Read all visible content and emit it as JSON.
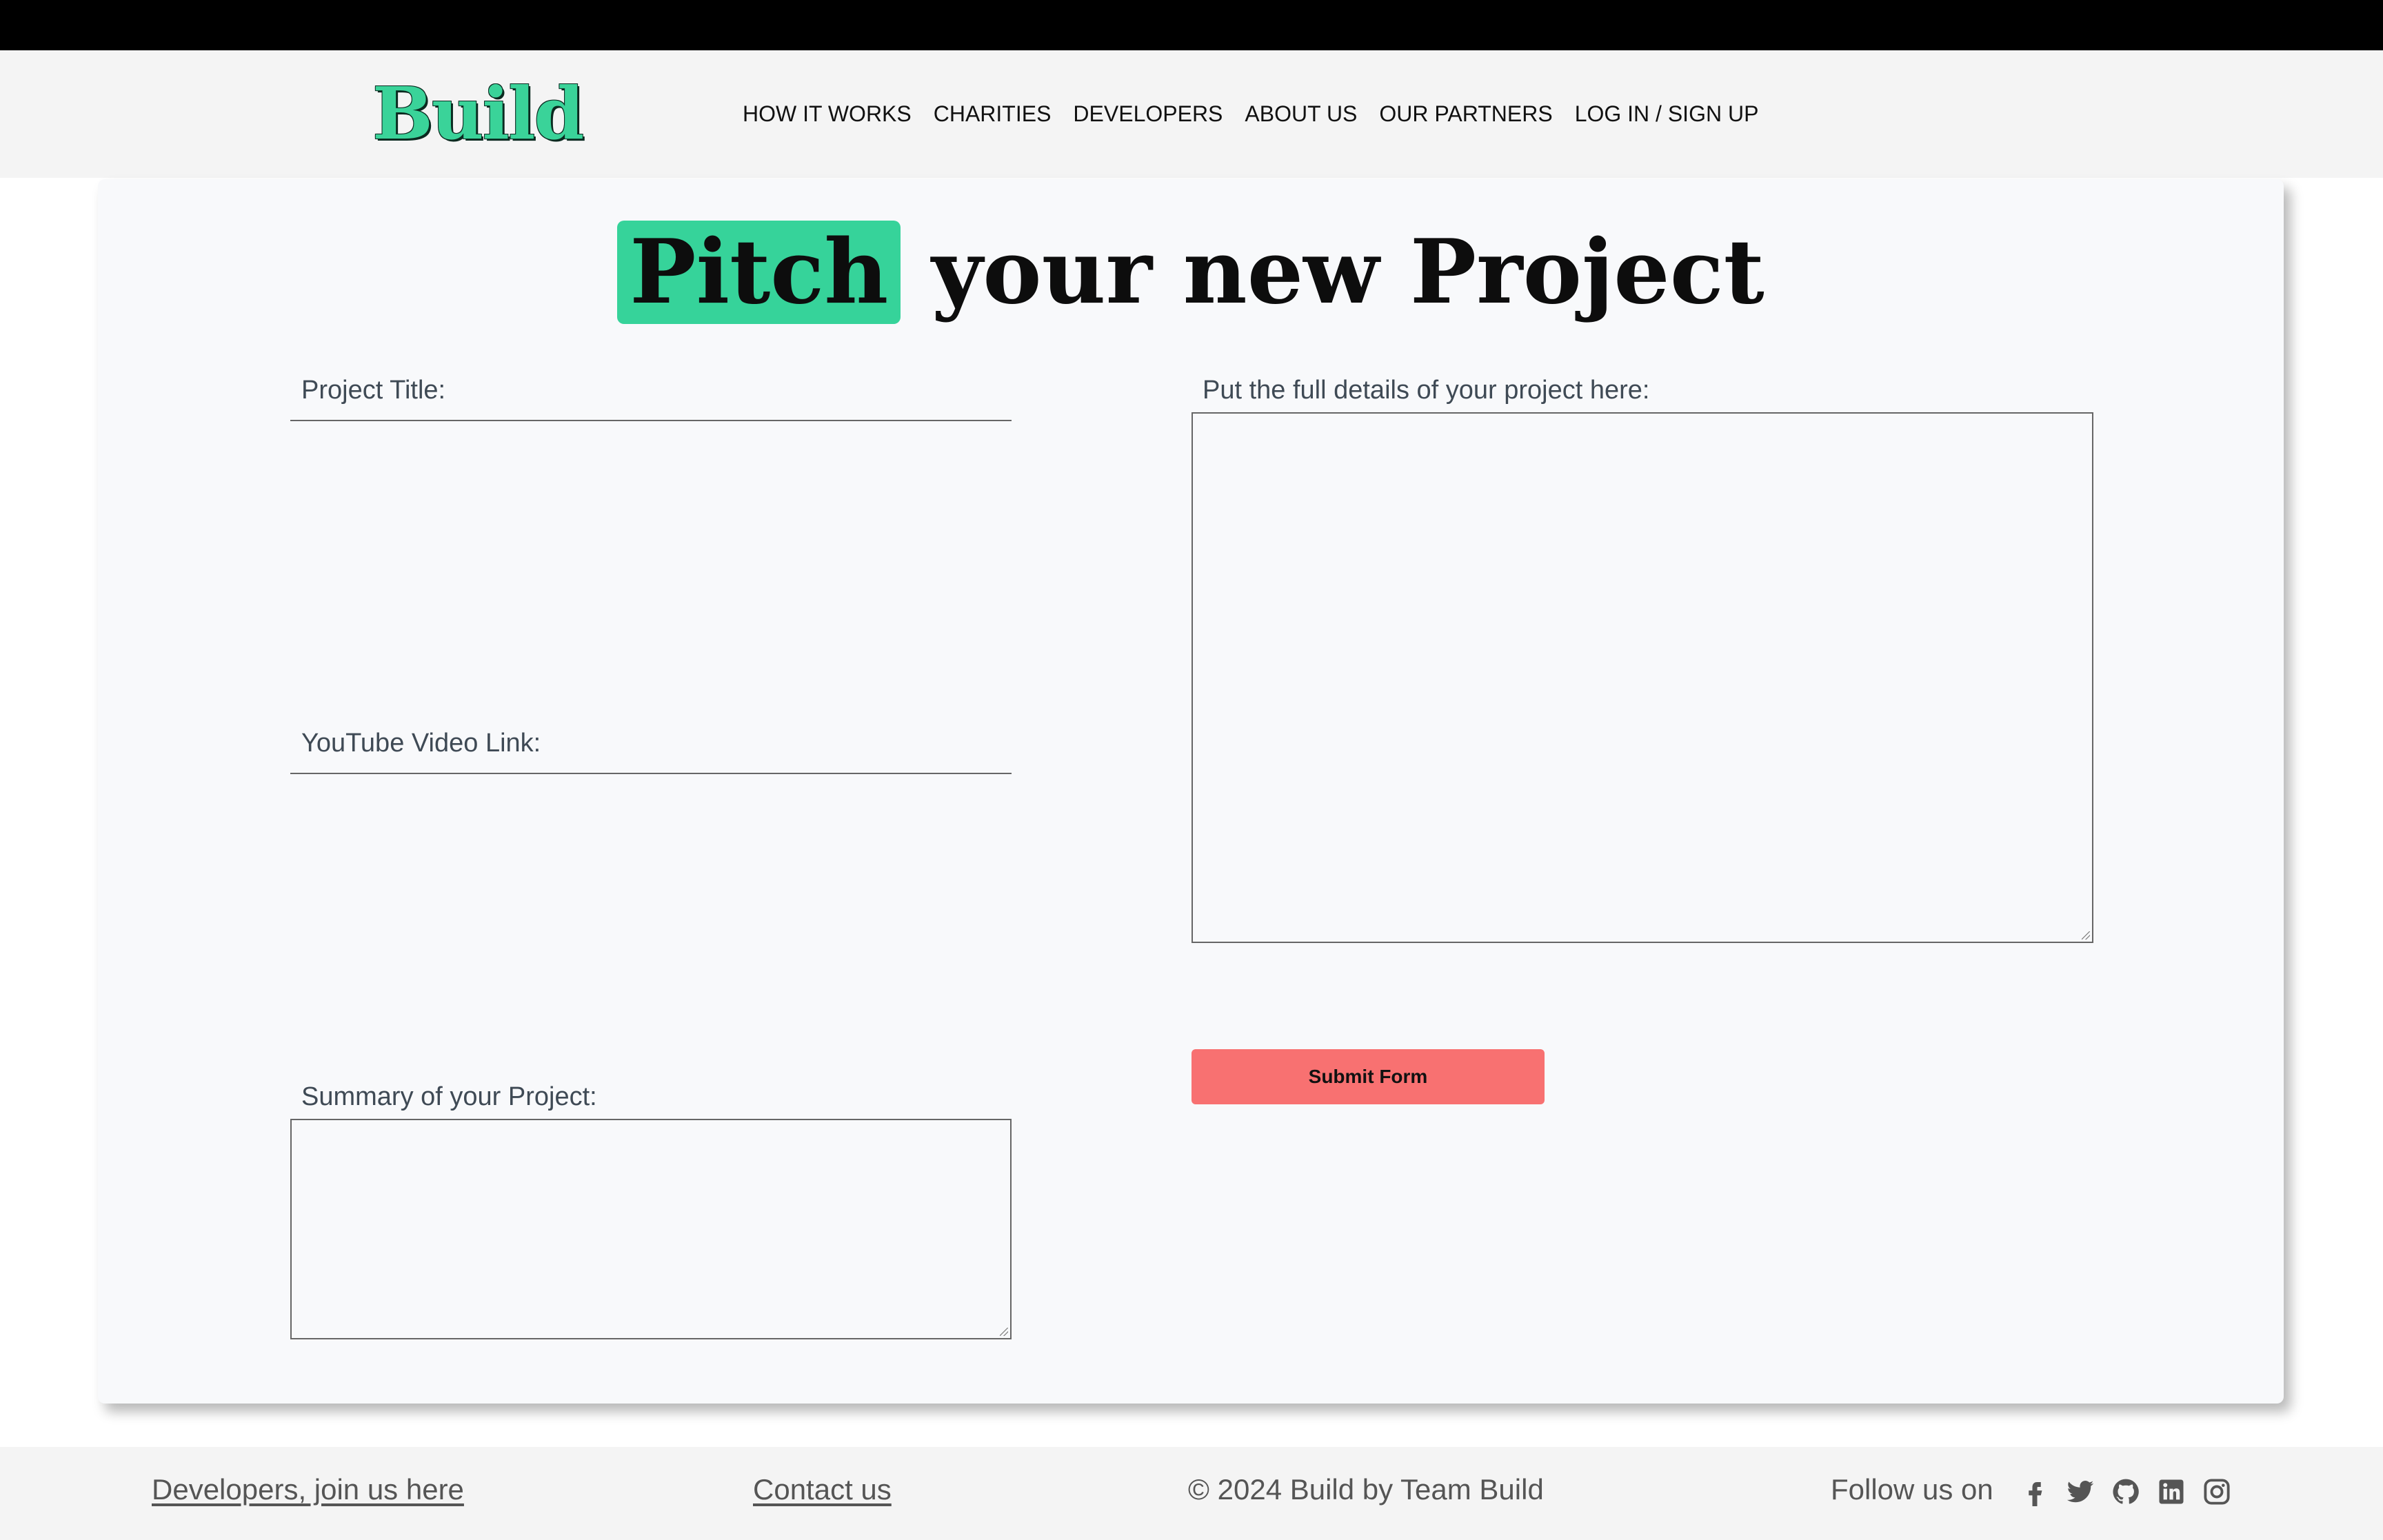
{
  "header": {
    "logo": "Build",
    "nav": [
      "HOW IT WORKS",
      "CHARITIES",
      "DEVELOPERS",
      "ABOUT US",
      "OUR PARTNERS",
      "LOG IN / SIGN UP"
    ]
  },
  "form": {
    "heading_highlight": "Pitch",
    "heading_rest": "your new Project",
    "project_title_label": "Project Title:",
    "youtube_label": "YouTube Video Link:",
    "summary_label": "Summary of your Project:",
    "details_label": "Put the full details of your project here:",
    "submit_label": "Submit Form"
  },
  "footer": {
    "developers_link": "Developers, join us here",
    "contact_link": "Contact us",
    "copyright": "© 2024 Build by Team Build",
    "follow_text": "Follow us on",
    "social_icons": [
      "facebook-icon",
      "twitter-icon",
      "github-icon",
      "linkedin-icon",
      "instagram-icon"
    ]
  },
  "colors": {
    "accent": "#36d39a",
    "submit": "#f87171"
  }
}
